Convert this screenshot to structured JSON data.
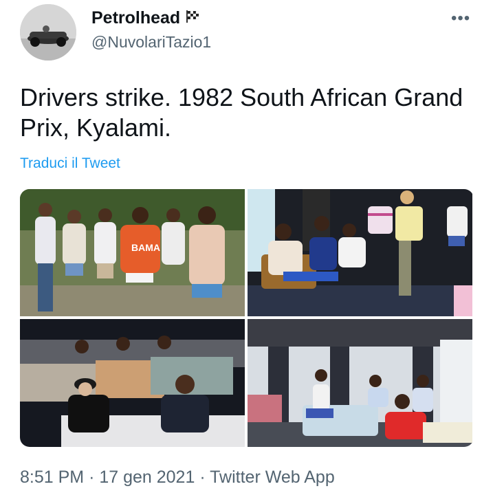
{
  "author": {
    "display_name": "Petrolhead",
    "handle": "@NuvolariTazio1",
    "badge_icon": "checkered-flag-icon"
  },
  "tweet": {
    "text": "Drivers strike. 1982 South African Grand Prix, Kyalami.",
    "translate_label": "Traduci il Tweet",
    "media_count": 4,
    "photo_shirt_text": "BAMA"
  },
  "meta": {
    "time": "8:51 PM",
    "date": "17 gen 2021",
    "source": "Twitter Web App",
    "separator": "·"
  },
  "colors": {
    "text": "#0f1419",
    "secondary": "#536471",
    "link": "#1d9bf0"
  }
}
